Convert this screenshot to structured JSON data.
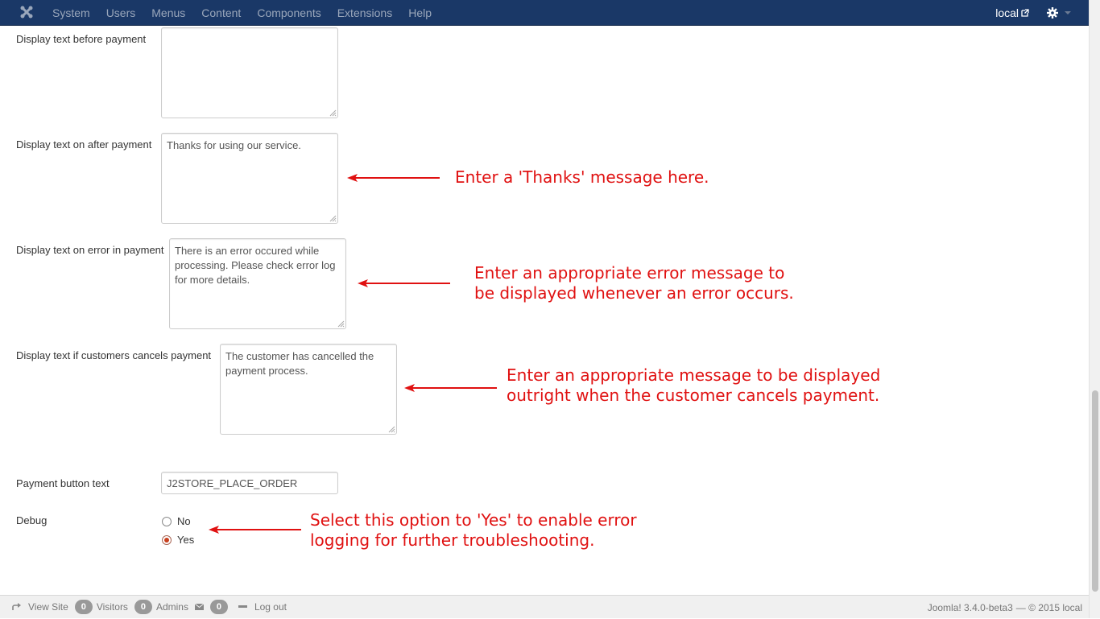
{
  "navbar": {
    "logo_icon": "joomla-logo-icon",
    "menu": [
      "System",
      "Users",
      "Menus",
      "Content",
      "Components",
      "Extensions",
      "Help"
    ],
    "site_label": "local",
    "site_icon": "external-link-icon",
    "settings_icon": "gear-icon"
  },
  "form": {
    "before_payment": {
      "label": "Display text before payment",
      "value": ""
    },
    "after_payment": {
      "label": "Display text on after payment",
      "value": "Thanks for using our service."
    },
    "error_payment": {
      "label": "Display text on error in payment",
      "value": "There is an error occured while processing. Please check error log for more details."
    },
    "cancel_payment": {
      "label": "Display text if customers cancels payment",
      "value": "The customer has cancelled the payment process."
    },
    "button_text": {
      "label": "Payment button text",
      "value": "J2STORE_PLACE_ORDER"
    },
    "debug": {
      "label": "Debug",
      "options": [
        "No",
        "Yes"
      ],
      "selected": "Yes"
    }
  },
  "annotations": {
    "thanks": "Enter a 'Thanks' message here.",
    "error_1": "Enter an appropriate error message to",
    "error_2": "be displayed whenever an error occurs.",
    "cancel_1": "Enter an appropriate message to be displayed",
    "cancel_2": "outright when the customer cancels payment.",
    "debug_1": "Select this option to 'Yes' to enable error",
    "debug_2": "logging for further troubleshooting.",
    "color": "#e01111"
  },
  "footer": {
    "view_site": "View Site",
    "visitors_count": "0",
    "visitors_label": "Visitors",
    "admins_count": "0",
    "admins_label": "Admins",
    "messages_count": "0",
    "logout": "Log out",
    "version": "Joomla! 3.4.0-beta3",
    "copyright": "— © 2015 local"
  },
  "colors": {
    "navbar_bg": "#1a3867",
    "footer_bg": "#f0f0f0"
  }
}
